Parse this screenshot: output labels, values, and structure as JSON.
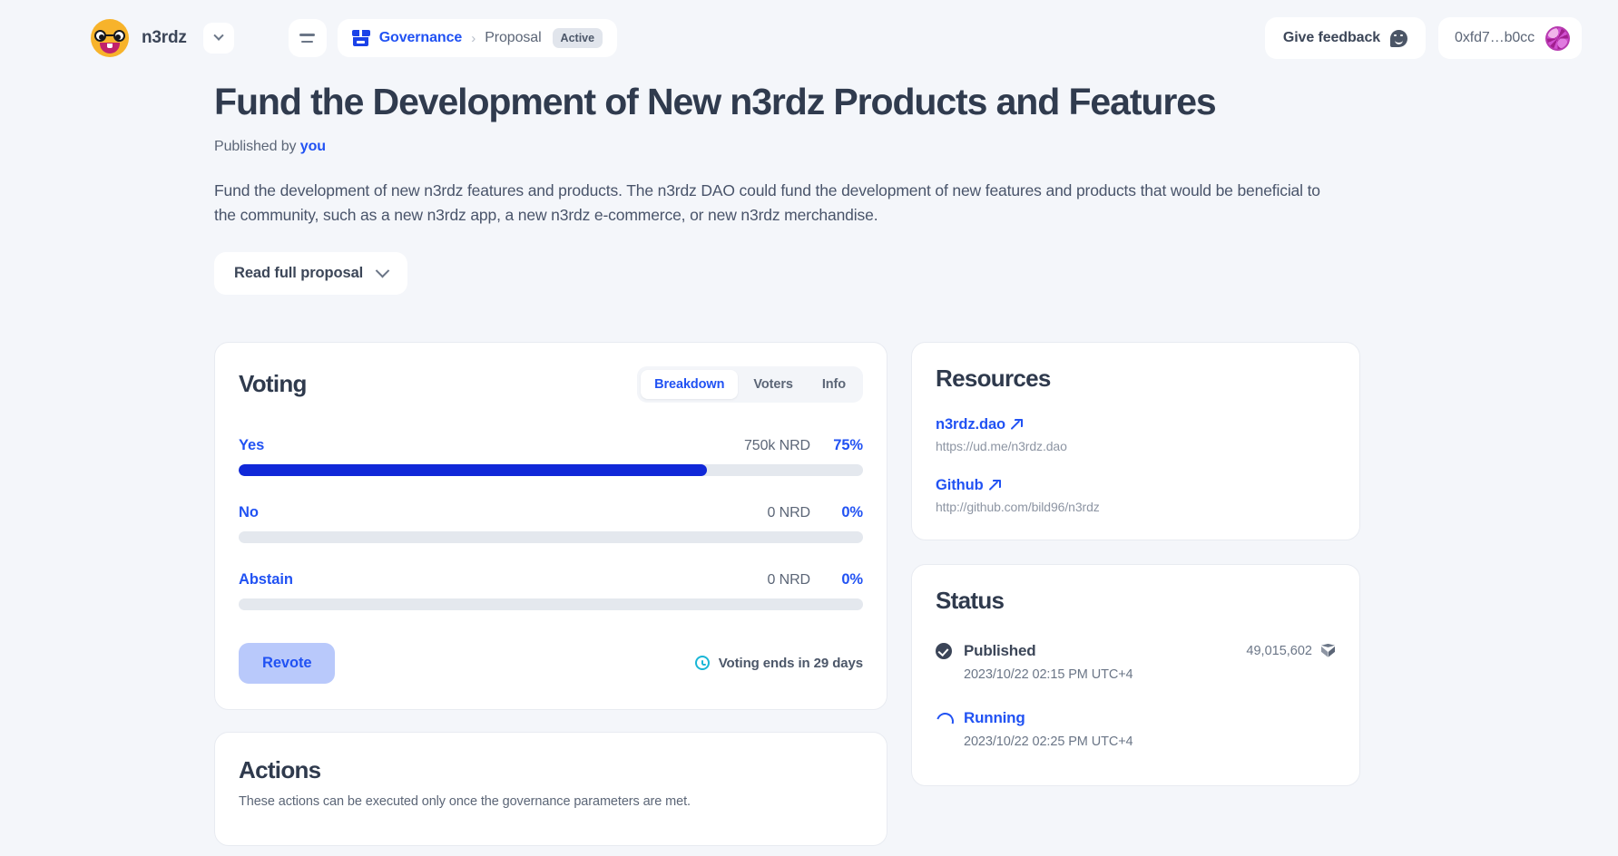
{
  "topbar": {
    "brand_name": "n3rdz",
    "brand_logo_icon": "nerd-face-emoji",
    "brand_caret_icon": "chevron-down-icon",
    "menu_icon": "hamburger-menu-icon",
    "governance_icon": "governance-box-icon",
    "breadcrumb": {
      "root_label": "Governance",
      "separator": "›",
      "current_label": "Proposal",
      "status_badge": "Active"
    },
    "feedback_label": "Give feedback",
    "feedback_icon": "smiley-chat-icon",
    "wallet_address": "0xfd7…b0cc",
    "wallet_avatar_icon": "wallet-identicon"
  },
  "proposal": {
    "title": "Fund the Development of New n3rdz Products and Features",
    "published_prefix": "Published by",
    "published_author": "you",
    "summary": "Fund the development of new n3rdz features and products. The n3rdz DAO could fund the development of new features and products that would be beneficial to the community, such as a new n3rdz app, a new n3rdz e-commerce, or new n3rdz merchandise.",
    "read_full_label": "Read full proposal",
    "read_full_icon": "chevron-down-icon"
  },
  "voting": {
    "title": "Voting",
    "tabs": [
      {
        "label": "Breakdown",
        "active": true
      },
      {
        "label": "Voters",
        "active": false
      },
      {
        "label": "Info",
        "active": false
      }
    ],
    "options": [
      {
        "label": "Yes",
        "amount": "750k NRD",
        "percent_label": "75%",
        "percent": 75
      },
      {
        "label": "No",
        "amount": "0 NRD",
        "percent_label": "0%",
        "percent": 0
      },
      {
        "label": "Abstain",
        "amount": "0 NRD",
        "percent_label": "0%",
        "percent": 0
      }
    ],
    "revote_label": "Revote",
    "ends_icon": "clock-icon",
    "ends_label": "Voting ends in 29 days"
  },
  "actions": {
    "title": "Actions",
    "subtitle": "These actions can be executed only once the governance parameters are met."
  },
  "resources": {
    "title": "Resources",
    "items": [
      {
        "label": "n3rdz.dao",
        "url": "https://ud.me/n3rdz.dao",
        "icon": "external-link-arrow-icon"
      },
      {
        "label": "Github",
        "url": "http://github.com/bild96/n3rdz",
        "icon": "external-link-arrow-icon"
      }
    ]
  },
  "status": {
    "title": "Status",
    "items": [
      {
        "name": "Published",
        "icon": "check-circle-icon",
        "time": "2023/10/22 02:15 PM UTC+4",
        "block": "49,015,602",
        "block_icon": "cube-icon",
        "running": false
      },
      {
        "name": "Running",
        "icon": "spinner-icon",
        "time": "2023/10/22 02:25 PM UTC+4",
        "block": "",
        "block_icon": "",
        "running": true
      }
    ]
  },
  "colors": {
    "accent_blue": "#2152f3",
    "bar_blue": "#1028d8",
    "page_bg": "#f4f6fa",
    "card_bg": "#ffffff",
    "track_gray": "#e4e8ee",
    "revote_bg": "#b9c9fb",
    "clock_teal": "#19b6d6"
  }
}
